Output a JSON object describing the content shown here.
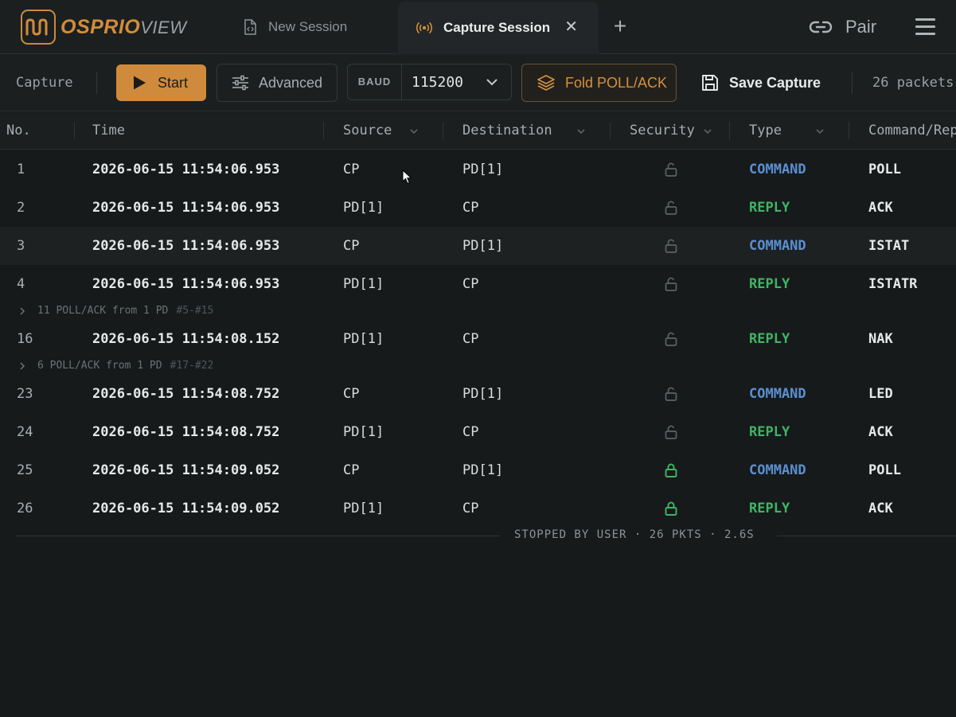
{
  "app": {
    "logo_primary": "OSPRIO",
    "logo_secondary": "VIEW"
  },
  "tabs": [
    {
      "label": "New Session",
      "icon": "file-code-icon",
      "active": false
    },
    {
      "label": "Capture Session",
      "icon": "broadcast-icon",
      "active": true
    }
  ],
  "header": {
    "pair_label": "Pair",
    "close_glyph": "✕",
    "add_glyph": "+"
  },
  "toolbar": {
    "section_label": "Capture",
    "start_label": "Start",
    "advanced_label": "Advanced",
    "baud_label": "BAUD",
    "baud_value": "115200",
    "fold_label": "Fold POLL/ACK",
    "save_label": "Save Capture",
    "packet_count": "26 packets"
  },
  "columns": [
    "No.",
    "Time",
    "Source",
    "Destination",
    "Security",
    "Type",
    "Command/Reply"
  ],
  "rows": [
    {
      "no": "1",
      "time": "2026-06-15 11:54:06.953",
      "src": "CP",
      "dst": "PD[1]",
      "secure": false,
      "type": "COMMAND",
      "cmd": "POLL"
    },
    {
      "no": "2",
      "time": "2026-06-15 11:54:06.953",
      "src": "PD[1]",
      "dst": "CP",
      "secure": false,
      "type": "REPLY",
      "cmd": "ACK"
    },
    {
      "no": "3",
      "time": "2026-06-15 11:54:06.953",
      "src": "CP",
      "dst": "PD[1]",
      "secure": false,
      "type": "COMMAND",
      "cmd": "ISTAT"
    },
    {
      "no": "4",
      "time": "2026-06-15 11:54:06.953",
      "src": "PD[1]",
      "dst": "CP",
      "secure": false,
      "type": "REPLY",
      "cmd": "ISTATR"
    },
    {
      "no": "16",
      "time": "2026-06-15 11:54:08.152",
      "src": "PD[1]",
      "dst": "CP",
      "secure": false,
      "type": "REPLY",
      "cmd": "NAK"
    },
    {
      "no": "23",
      "time": "2026-06-15 11:54:08.752",
      "src": "CP",
      "dst": "PD[1]",
      "secure": false,
      "type": "COMMAND",
      "cmd": "LED"
    },
    {
      "no": "24",
      "time": "2026-06-15 11:54:08.752",
      "src": "PD[1]",
      "dst": "CP",
      "secure": false,
      "type": "REPLY",
      "cmd": "ACK"
    },
    {
      "no": "25",
      "time": "2026-06-15 11:54:09.052",
      "src": "CP",
      "dst": "PD[1]",
      "secure": true,
      "type": "COMMAND",
      "cmd": "POLL"
    },
    {
      "no": "26",
      "time": "2026-06-15 11:54:09.052",
      "src": "PD[1]",
      "dst": "CP",
      "secure": true,
      "type": "REPLY",
      "cmd": "ACK"
    }
  ],
  "groups": [
    {
      "text": "11 POLL/ACK from 1 PD",
      "range": "#5-#15"
    },
    {
      "text": "6 POLL/ACK from 1 PD",
      "range": "#17-#22"
    }
  ],
  "footer": "STOPPED BY USER · 26 PKTS · 2.6S",
  "colors": {
    "accent": "#d08a3c",
    "command": "#5b8fd0",
    "reply": "#3fb563",
    "lock_secure": "#3fb563",
    "lock_open": "#5d6366"
  }
}
